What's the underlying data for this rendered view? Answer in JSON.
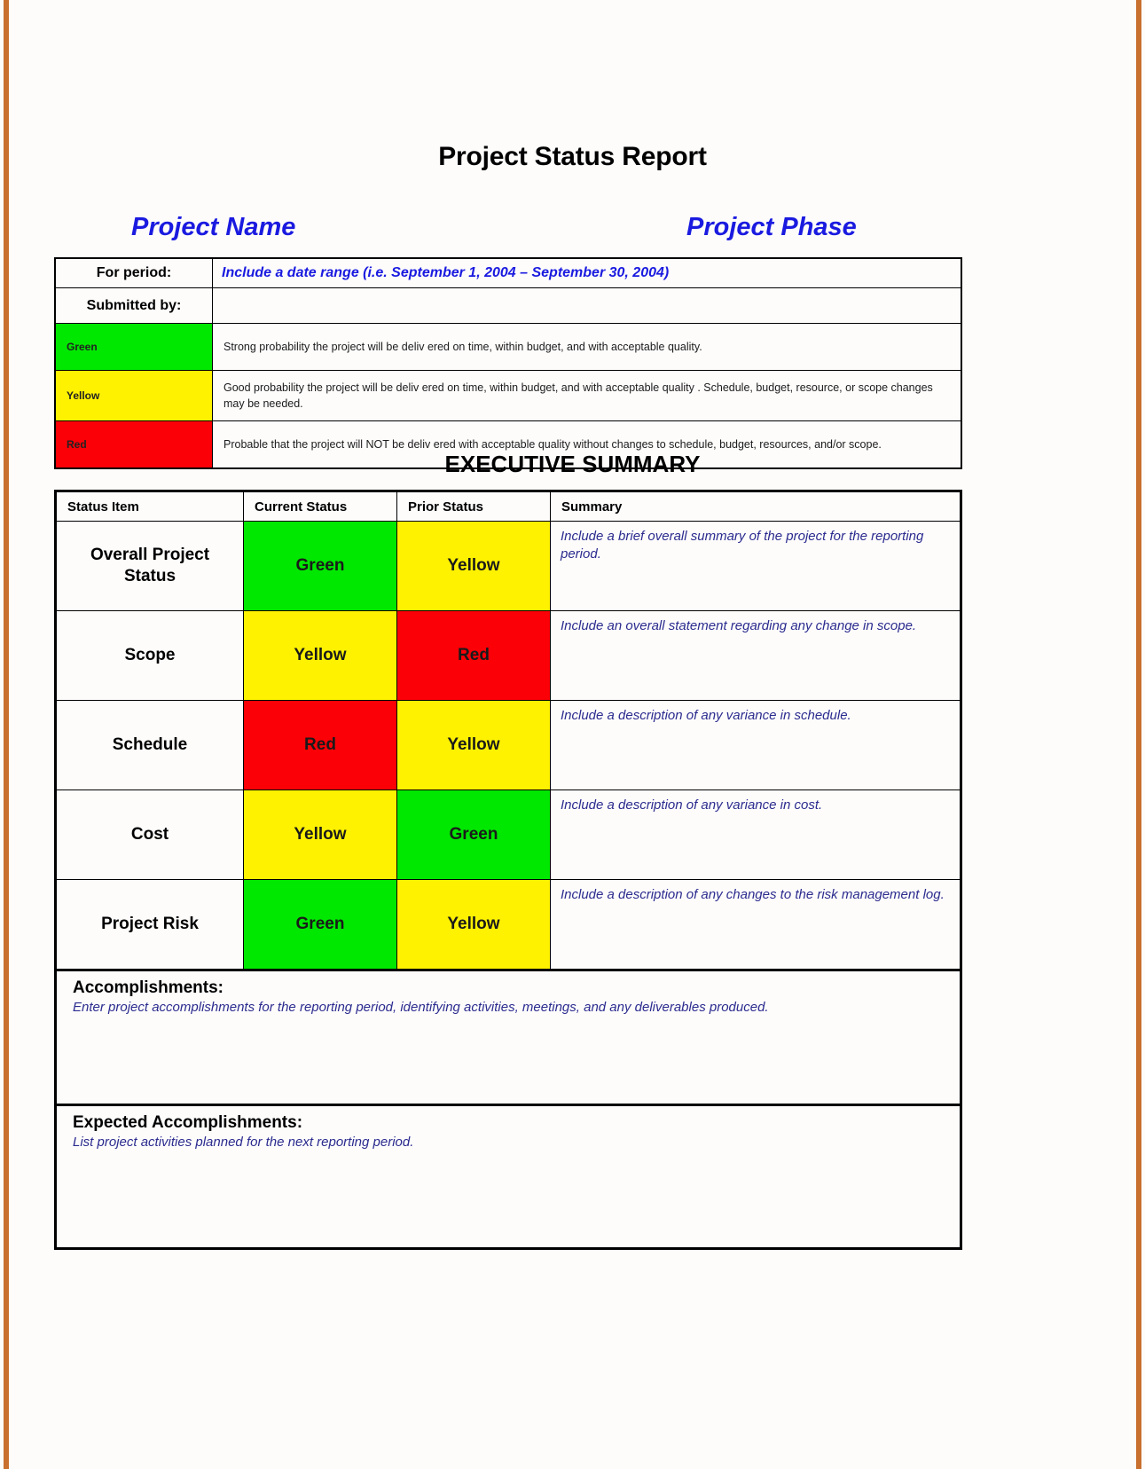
{
  "document": {
    "title": "Project Status Report",
    "project_name": "Project Name",
    "project_phase": "Project Phase"
  },
  "info": {
    "for_period_label": "For period:",
    "for_period_value": "Include a date range (i.e. September 1, 2004 – September 30, 2004)",
    "submitted_by_label": "Submitted by:",
    "submitted_by_value": "",
    "legend": [
      {
        "label": "Green",
        "color": "#00e800",
        "description": "Strong probability  the project will be deliv ered on time, within budget, and with acceptable quality."
      },
      {
        "label": "Yellow",
        "color": "#fff200",
        "description": "Good probability the project will be deliv ered on time, within budget, and with acceptable quality . Schedule, budget, resource, or scope changes may be needed."
      },
      {
        "label": "Red",
        "color": "#fb0007",
        "description": "Probable that the project will NOT be deliv ered with acceptable quality without changes to schedule, budget, resources, and/or scope."
      }
    ]
  },
  "exec_summary": {
    "heading": "EXECUTIVE SUMMARY",
    "columns": {
      "status_item": "Status Item",
      "current_status": "Current Status",
      "prior_status": "Prior Status",
      "summary": "Summary"
    },
    "rows": [
      {
        "item": "Overall Project Status",
        "current": "Green",
        "current_color": "#00e800",
        "prior": "Yellow",
        "prior_color": "#fff200",
        "summary": "Include a brief overall summary of the project for the reporting period."
      },
      {
        "item": "Scope",
        "current": "Yellow",
        "current_color": "#fff200",
        "prior": "Red",
        "prior_color": "#fb0007",
        "summary": "Include an overall statement regarding any change in scope."
      },
      {
        "item": "Schedule",
        "current": "Red",
        "current_color": "#fb0007",
        "prior": "Yellow",
        "prior_color": "#fff200",
        "summary": "Include a description of any variance in schedule."
      },
      {
        "item": "Cost",
        "current": "Yellow",
        "current_color": "#fff200",
        "prior": "Green",
        "prior_color": "#00e800",
        "summary": "Include a description of any variance in cost."
      },
      {
        "item": "Project Risk",
        "current": "Green",
        "current_color": "#00e800",
        "prior": "Yellow",
        "prior_color": "#fff200",
        "summary": "Include a description of any changes to the risk management log."
      }
    ],
    "accomplishments": {
      "heading": "Accomplishments:",
      "placeholder": "Enter project accomplishments for the reporting period, identifying activities, meetings, and any deliverables produced.",
      "value": ""
    },
    "expected_accomplishments": {
      "heading": "Expected Accomplishments:",
      "placeholder": "List project activities planned for the next reporting period.",
      "value": ""
    }
  },
  "colors": {
    "page_edge": "#c9702f",
    "accent_blue": "#1a1ae0",
    "text_blue": "#2b2b8f"
  }
}
